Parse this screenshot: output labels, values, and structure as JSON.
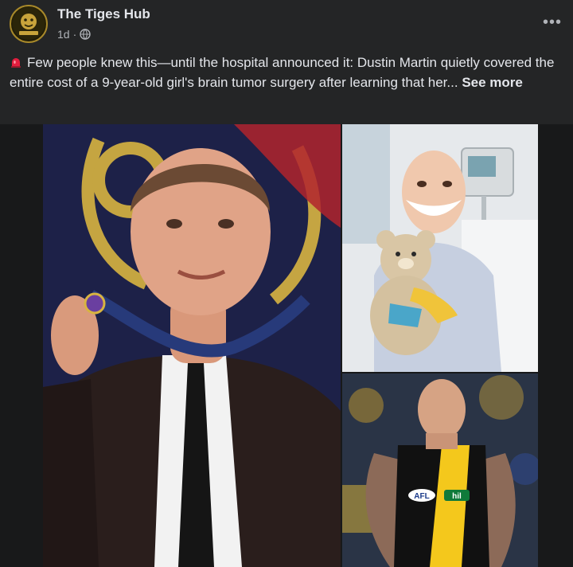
{
  "post": {
    "page_name": "The Tiges Hub",
    "timestamp": "1d",
    "separator": "·",
    "audience_icon": "globe-icon",
    "more_icon": "more-options-icon",
    "more_label": "•••",
    "text": "Few people knew this—until the hospital announced it: Dustin Martin quietly covered the entire cost of a 9-year-old girl's brain tumor surgery after learning that her...",
    "see_more_label": "See more",
    "leading_emoji_icon": "siren-icon"
  },
  "images": {
    "bottom_right_jersey_logos": [
      "AFL",
      "hil"
    ]
  },
  "colors": {
    "background": "#18191a",
    "card": "#242526",
    "text_primary": "#e4e6eb",
    "text_secondary": "#b0b3b8",
    "siren_red": "#e41e3f"
  }
}
